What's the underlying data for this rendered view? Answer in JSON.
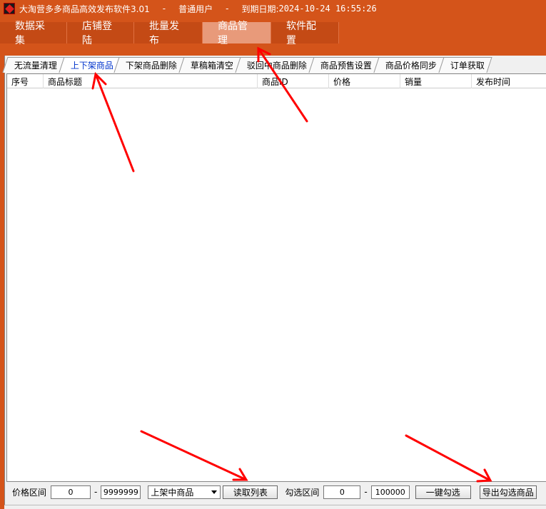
{
  "window": {
    "title": "大淘营多多商品高效发布软件3.01",
    "sep1": "-",
    "user_type": "普通用户",
    "sep2": "-",
    "expiry_label": "到期日期:",
    "expiry_value": "2024-10-24 16:55:26"
  },
  "menu": {
    "items": [
      {
        "label": "数据采集"
      },
      {
        "label": "店铺登陆"
      },
      {
        "label": "批量发布"
      },
      {
        "label": "商品管理"
      },
      {
        "label": "软件配置"
      }
    ],
    "active": "商品管理"
  },
  "subtabs": {
    "items": [
      {
        "label": "无流量清理"
      },
      {
        "label": "上下架商品"
      },
      {
        "label": "下架商品删除"
      },
      {
        "label": "草稿箱清空"
      },
      {
        "label": "驳回中商品删除"
      },
      {
        "label": "商品预售设置"
      },
      {
        "label": "商品价格同步"
      },
      {
        "label": "订单获取"
      }
    ],
    "active": "上下架商品"
  },
  "list": {
    "columns": [
      "序号",
      "商品标题",
      "商品ID",
      "价格",
      "销量",
      "发布时间"
    ],
    "rows": []
  },
  "bottom": {
    "price_label": "价格区间",
    "price_min": "0",
    "price_dash": "-",
    "price_max": "9999999",
    "status_selected": "上架中商品",
    "read_list_label": "读取列表",
    "check_range_label": "勾选区间",
    "check_min": "0",
    "check_dash": "-",
    "check_max": "100000",
    "check_all_label": "一键勾选",
    "export_label": "导出勾选商品"
  },
  "colors": {
    "brand": "#d4541a",
    "active_menu": "#e89a7a",
    "active_tab_text": "#0033cc",
    "annotation_arrow": "#ff0000"
  }
}
